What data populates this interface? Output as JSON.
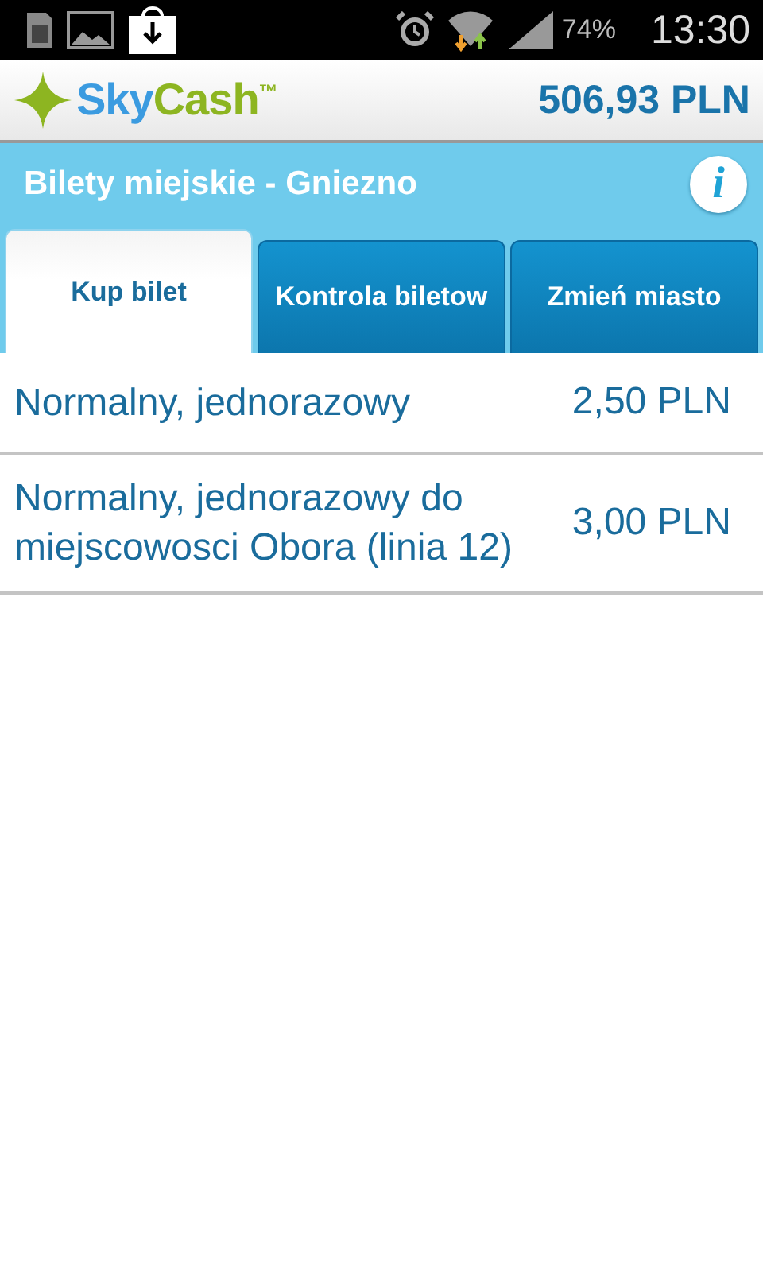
{
  "status_bar": {
    "battery": "74%",
    "time": "13:30"
  },
  "header": {
    "logo": {
      "first": "Sky",
      "second": "Cash",
      "mark": "™"
    },
    "balance": "506,93 PLN"
  },
  "title_bar": {
    "title": "Bilety miejskie - Gniezno",
    "info": "i"
  },
  "tabs": [
    {
      "label": "Kup bilet",
      "selected": true
    },
    {
      "label": "Kontrola biletow",
      "selected": false
    },
    {
      "label": "Zmień miasto",
      "selected": false
    }
  ],
  "tickets": [
    {
      "name": "Normalny, jednorazowy",
      "price": "2,50 PLN"
    },
    {
      "name": "Normalny, jednorazowy do miejscowosci Obora (linia 12)",
      "price": "3,00 PLN"
    }
  ]
}
